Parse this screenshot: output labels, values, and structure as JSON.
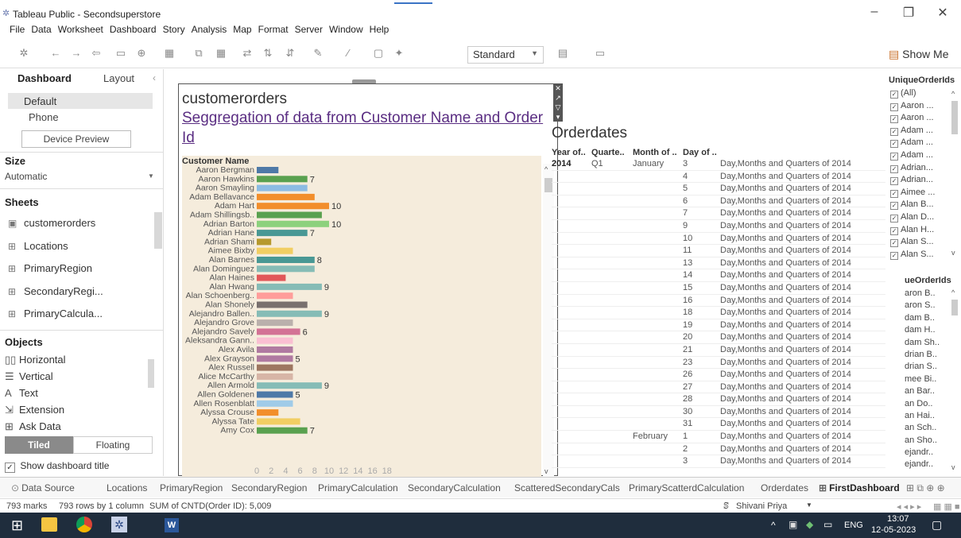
{
  "window": {
    "title": "Tableau Public - Secondsuperstore"
  },
  "menu": [
    "File",
    "Data",
    "Worksheet",
    "Dashboard",
    "Story",
    "Analysis",
    "Map",
    "Format",
    "Server",
    "Window",
    "Help"
  ],
  "toolbar": {
    "view_select": "Standard",
    "show_me": "Show Me"
  },
  "left": {
    "tab_dashboard": "Dashboard",
    "tab_layout": "Layout",
    "device_default": "Default",
    "device_phone": "Phone",
    "device_preview": "Device Preview",
    "size_head": "Size",
    "size_value": "Automatic",
    "sheets_head": "Sheets",
    "sheets": [
      "customerorders",
      "Locations",
      "PrimaryRegion",
      "SecondaryRegi...",
      "PrimaryCalcula..."
    ],
    "objects_head": "Objects",
    "objects": [
      "Horizontal",
      "Vertical",
      "Text",
      "Extension",
      "Ask Data"
    ],
    "tiled": "Tiled",
    "floating": "Floating",
    "show_title": "Show dashboard title"
  },
  "customerorders": {
    "title": "customerorders",
    "subtitle": "Seggregation of data from Customer Name and Order Id",
    "column_header": "Customer Name"
  },
  "chart_data": {
    "type": "bar",
    "orientation": "horizontal",
    "categories": [
      "Aaron Bergman",
      "Aaron Hawkins",
      "Aaron Smayling",
      "Adam Bellavance",
      "Adam Hart",
      "Adam Shillingsb..",
      "Adrian Barton",
      "Adrian Hane",
      "Adrian Shami",
      "Aimee Bixby",
      "Alan Barnes",
      "Alan Dominguez",
      "Alan Haines",
      "Alan Hwang",
      "Alan Schoenberg..",
      "Alan Shonely",
      "Alejandro Ballen..",
      "Alejandro Grove",
      "Alejandro Savely",
      "Aleksandra Gann..",
      "Alex Avila",
      "Alex Grayson",
      "Alex Russell",
      "Alice McCarthy",
      "Allen Armold",
      "Allen Goldenen",
      "Allen Rosenblatt",
      "Alyssa Crouse",
      "Alyssa Tate",
      "Amy Cox"
    ],
    "values": [
      3,
      7,
      7,
      8,
      10,
      9,
      10,
      7,
      2,
      5,
      8,
      8,
      4,
      9,
      5,
      7,
      9,
      5,
      6,
      5,
      5,
      5,
      5,
      5,
      9,
      5,
      5,
      3,
      6,
      7
    ],
    "labels": [
      "",
      "7",
      "",
      "",
      "10",
      "",
      "10",
      "7",
      "",
      "",
      "8",
      "",
      "",
      "9",
      "",
      "",
      "9",
      "",
      "6",
      "",
      "",
      "5",
      "",
      "",
      "9",
      "5",
      "",
      "",
      "",
      "7"
    ],
    "colors": [
      "#4e79a7",
      "#59a14f",
      "#8cbce3",
      "#f28e2b",
      "#f28e2b",
      "#59a14f",
      "#8cd17d",
      "#499894",
      "#b6992d",
      "#f1ce63",
      "#499894",
      "#86bcb6",
      "#e15759",
      "#86bcb6",
      "#ff9d9a",
      "#79706e",
      "#86bcb6",
      "#bab0ac",
      "#d37295",
      "#fabfd2",
      "#b07aa1",
      "#b07aa1",
      "#9d7660",
      "#d7b5a6",
      "#86bcb6",
      "#4e79a7",
      "#a0cbe8",
      "#f28e2b",
      "#f1ce63",
      "#59a14f"
    ],
    "x_ticks": [
      "0",
      "2",
      "4",
      "6",
      "8",
      "10",
      "12",
      "14",
      "16",
      "18"
    ],
    "xlim": [
      0,
      18
    ]
  },
  "orderdates": {
    "title": "Orderdates",
    "headers": [
      "Year of..",
      "Quarte..",
      "Month of ..",
      "Day of .."
    ],
    "year": "2014",
    "quarter": "Q1",
    "desc": "Day,Months and Quarters of 2014",
    "rows": [
      {
        "month": "January",
        "day": "3"
      },
      {
        "month": "",
        "day": "4"
      },
      {
        "month": "",
        "day": "5"
      },
      {
        "month": "",
        "day": "6"
      },
      {
        "month": "",
        "day": "7"
      },
      {
        "month": "",
        "day": "9"
      },
      {
        "month": "",
        "day": "10"
      },
      {
        "month": "",
        "day": "11"
      },
      {
        "month": "",
        "day": "13"
      },
      {
        "month": "",
        "day": "14"
      },
      {
        "month": "",
        "day": "15"
      },
      {
        "month": "",
        "day": "16"
      },
      {
        "month": "",
        "day": "18"
      },
      {
        "month": "",
        "day": "19"
      },
      {
        "month": "",
        "day": "20"
      },
      {
        "month": "",
        "day": "21"
      },
      {
        "month": "",
        "day": "23"
      },
      {
        "month": "",
        "day": "26"
      },
      {
        "month": "",
        "day": "27"
      },
      {
        "month": "",
        "day": "28"
      },
      {
        "month": "",
        "day": "30"
      },
      {
        "month": "",
        "day": "31"
      },
      {
        "month": "February",
        "day": "1"
      },
      {
        "month": "",
        "day": "2"
      },
      {
        "month": "",
        "day": "3"
      }
    ]
  },
  "filter1": {
    "title": "UniqueOrderIds",
    "items": [
      "(All)",
      "Aaron ...",
      "Aaron ...",
      "Adam ...",
      "Adam ...",
      "Adam ...",
      "Adrian...",
      "Adrian...",
      "Aimee ...",
      "Alan B...",
      "Alan D...",
      "Alan H...",
      "Alan S...",
      "Alan S..."
    ]
  },
  "filter2": {
    "title": "ueOrderIds",
    "items": [
      "aron B..",
      "aron S..",
      "dam B..",
      "dam H..",
      "dam Sh..",
      "drian B..",
      "drian S..",
      "mee Bi..",
      "an Bar..",
      "an Do..",
      "an Hai..",
      "an Sch..",
      "an Sho..",
      "ejandr..",
      "ejandr.."
    ]
  },
  "tabs": [
    "Data Source",
    "Locations",
    "PrimaryRegion",
    "SecondaryRegion",
    "PrimaryCalculation",
    "SecondaryCalculation",
    "ScatteredSecondaryCals",
    "PrimaryScatterdCalculation",
    "Orderdates",
    "FirstDashboard"
  ],
  "status": {
    "marks": "793 marks",
    "rows": "793 rows by 1 column",
    "sum": "SUM of CNTD(Order ID): 5,009",
    "user": "Shivani Priya"
  },
  "taskbar": {
    "lang": "ENG",
    "time": "13:07",
    "date": "12-05-2023"
  }
}
